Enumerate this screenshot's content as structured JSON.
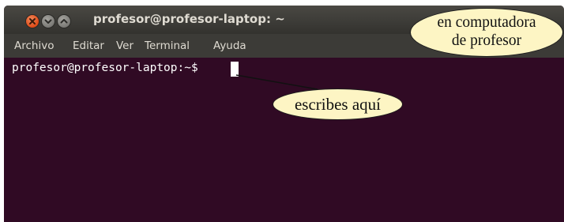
{
  "window": {
    "title": "profesor@profesor-laptop: ~"
  },
  "window_controls": [
    {
      "icon": "close-icon",
      "color": "#df4a16"
    },
    {
      "icon": "minimize-icon",
      "color": "#7a7975"
    },
    {
      "icon": "maximize-icon",
      "color": "#7a7975"
    }
  ],
  "menubar": {
    "items": [
      "Archivo",
      "Editar",
      "Ver",
      "Terminal",
      "Ayuda"
    ]
  },
  "terminal": {
    "prompt": "profesor@profesor-laptop:~$",
    "background": "#300a24"
  },
  "annotations": {
    "escribes": "escribes aquí",
    "computadora_line1": "en computadora",
    "computadora_line2": "de profesor",
    "fill": "#fdf5c4"
  }
}
